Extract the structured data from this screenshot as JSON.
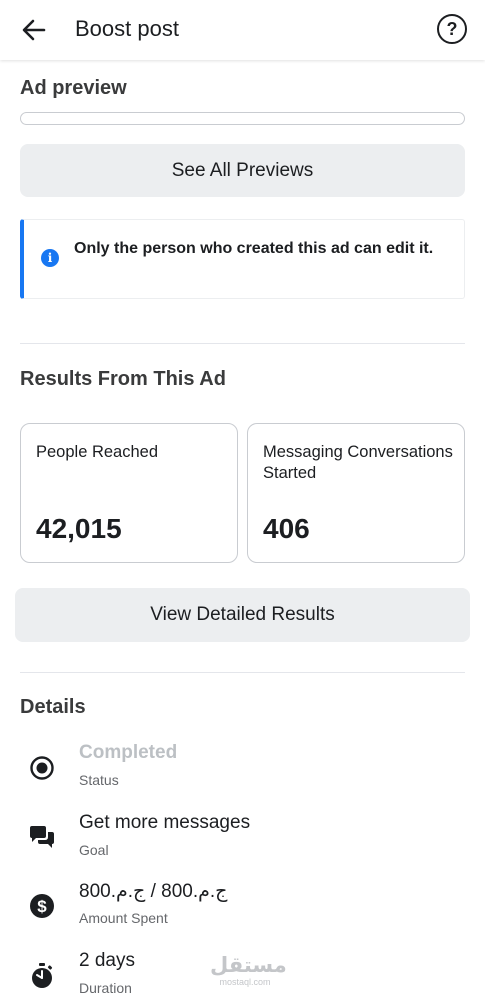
{
  "header": {
    "title": "Boost post",
    "back_icon": "arrow-left-icon",
    "help_label": "?"
  },
  "ad_preview": {
    "title": "Ad preview",
    "see_all_label": "See All Previews"
  },
  "notice": {
    "icon": "info-icon",
    "text": "Only the person who created this ad can edit it."
  },
  "results": {
    "title": "Results From This Ad",
    "cards": [
      {
        "label": "People Reached",
        "value": "42,015"
      },
      {
        "label": "Messaging Conversations Started",
        "value": "406"
      }
    ],
    "view_detailed_label": "View Detailed Results"
  },
  "details": {
    "title": "Details",
    "rows": [
      {
        "icon": "radio-target-icon",
        "value": "Completed",
        "label": "Status"
      },
      {
        "icon": "chat-bubbles-icon",
        "value": "Get more messages",
        "label": "Goal"
      },
      {
        "icon": "dollar-coin-icon",
        "value": "ج.م.‏800 / ج.م.‏800",
        "label": "Amount Spent"
      },
      {
        "icon": "stopwatch-icon",
        "value": "2 days",
        "label": "Duration"
      }
    ]
  },
  "watermark": {
    "text": "مستقل",
    "sub": "mostaql.com"
  },
  "colors": {
    "accent": "#1877f2",
    "button_bg": "#eceef0",
    "muted": "#bcc0c4"
  }
}
